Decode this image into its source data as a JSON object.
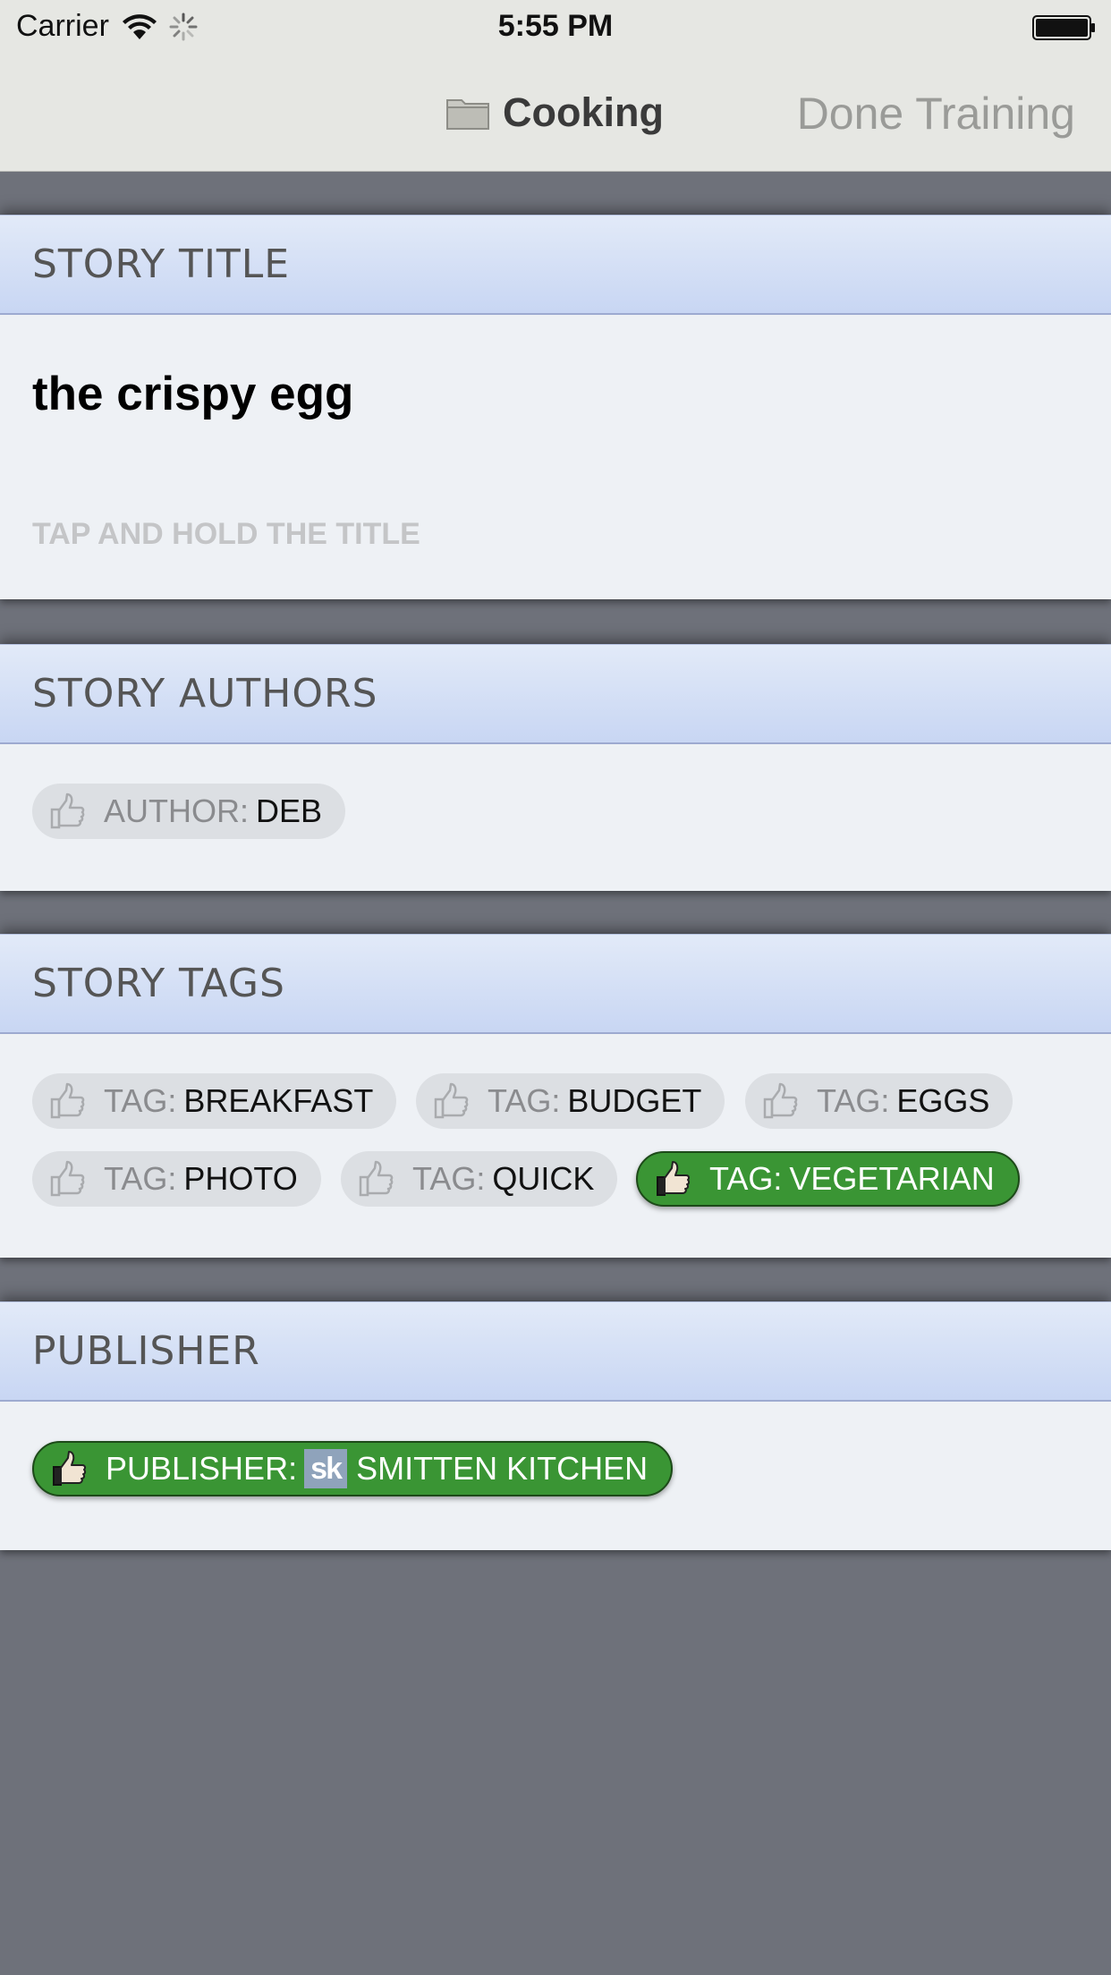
{
  "status_bar": {
    "carrier": "Carrier",
    "time": "5:55 PM"
  },
  "nav": {
    "folder_icon": "folder-icon",
    "folder_title": "Cooking",
    "done_label": "Done Training"
  },
  "sections": {
    "title": {
      "header": "STORY TITLE",
      "story_title": "the crispy egg",
      "hint": "TAP AND HOLD THE TITLE"
    },
    "authors": {
      "header": "STORY AUTHORS",
      "items": [
        {
          "prefix": "AUTHOR:",
          "value": "DEB",
          "state": "neutral"
        }
      ]
    },
    "tags": {
      "header": "STORY TAGS",
      "items": [
        {
          "prefix": "TAG:",
          "value": "BREAKFAST",
          "state": "neutral"
        },
        {
          "prefix": "TAG:",
          "value": "BUDGET",
          "state": "neutral"
        },
        {
          "prefix": "TAG:",
          "value": "EGGS",
          "state": "neutral"
        },
        {
          "prefix": "TAG:",
          "value": "PHOTO",
          "state": "neutral"
        },
        {
          "prefix": "TAG:",
          "value": "QUICK",
          "state": "neutral"
        },
        {
          "prefix": "TAG:",
          "value": "VEGETARIAN",
          "state": "positive"
        }
      ]
    },
    "publisher": {
      "header": "PUBLISHER",
      "items": [
        {
          "prefix": "PUBLISHER:",
          "logo": "sk",
          "value": "SMITTEN KITCHEN",
          "state": "positive"
        }
      ]
    }
  },
  "colors": {
    "positive": "#3a9534",
    "neutral_pill": "#dcdfe3",
    "header_gradient_top": "#e2eaf8",
    "header_gradient_bottom": "#c8d6f3",
    "background": "#6e717a"
  }
}
